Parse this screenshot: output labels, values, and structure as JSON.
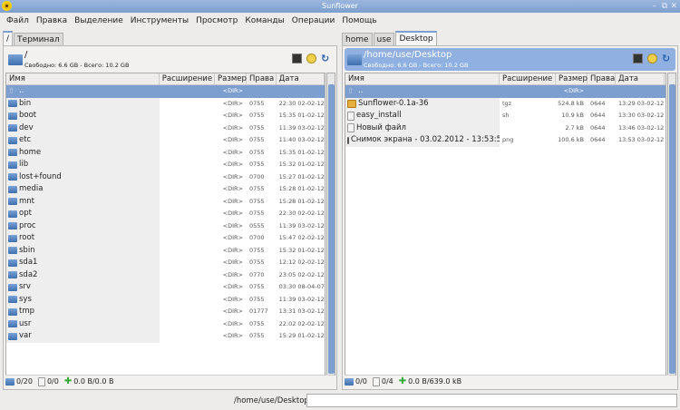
{
  "window": {
    "title": "Sunflower",
    "minimize": "–",
    "maximize": "⧉",
    "close": "✕"
  },
  "menu": [
    "Файл",
    "Правка",
    "Выделение",
    "Инструменты",
    "Просмотр",
    "Команды",
    "Операции",
    "Помощь"
  ],
  "columns": {
    "name": "Имя",
    "ext": "Расширение",
    "size": "Размер",
    "perms": "Права",
    "date": "Дата"
  },
  "left": {
    "tabs": [
      {
        "label": "/",
        "active": true
      },
      {
        "label": "Терминал",
        "active": false
      }
    ],
    "path": "/",
    "free": "Свободно: 6.6 GB - Всего: 10.2 GB",
    "rows": [
      {
        "name": "..",
        "ext": "",
        "size": "<DIR>",
        "perms": "",
        "date": "",
        "icon": "up"
      },
      {
        "name": "bin",
        "ext": "",
        "size": "<DIR>",
        "perms": "0755",
        "date": "22:30 02-02-12",
        "icon": "folder"
      },
      {
        "name": "boot",
        "ext": "",
        "size": "<DIR>",
        "perms": "0755",
        "date": "15:35 01-02-12",
        "icon": "folder"
      },
      {
        "name": "dev",
        "ext": "",
        "size": "<DIR>",
        "perms": "0755",
        "date": "11:39 03-02-12",
        "icon": "folder"
      },
      {
        "name": "etc",
        "ext": "",
        "size": "<DIR>",
        "perms": "0755",
        "date": "11:40 03-02-12",
        "icon": "folder"
      },
      {
        "name": "home",
        "ext": "",
        "size": "<DIR>",
        "perms": "0755",
        "date": "15:35 01-02-12",
        "icon": "folder"
      },
      {
        "name": "lib",
        "ext": "",
        "size": "<DIR>",
        "perms": "0755",
        "date": "15:32 01-02-12",
        "icon": "folder"
      },
      {
        "name": "lost+found",
        "ext": "",
        "size": "<DIR>",
        "perms": "0700",
        "date": "15:27 01-02-12",
        "icon": "folder"
      },
      {
        "name": "media",
        "ext": "",
        "size": "<DIR>",
        "perms": "0755",
        "date": "15:28 01-02-12",
        "icon": "folder"
      },
      {
        "name": "mnt",
        "ext": "",
        "size": "<DIR>",
        "perms": "0755",
        "date": "15:28 01-02-12",
        "icon": "folder"
      },
      {
        "name": "opt",
        "ext": "",
        "size": "<DIR>",
        "perms": "0755",
        "date": "22:30 02-02-12",
        "icon": "folder"
      },
      {
        "name": "proc",
        "ext": "",
        "size": "<DIR>",
        "perms": "0555",
        "date": "11:39 03-02-12",
        "icon": "folder"
      },
      {
        "name": "root",
        "ext": "",
        "size": "<DIR>",
        "perms": "0700",
        "date": "15:47 02-02-12",
        "icon": "folder"
      },
      {
        "name": "sbin",
        "ext": "",
        "size": "<DIR>",
        "perms": "0755",
        "date": "15:32 01-02-12",
        "icon": "folder"
      },
      {
        "name": "sda1",
        "ext": "",
        "size": "<DIR>",
        "perms": "0755",
        "date": "12:12 02-02-12",
        "icon": "folder"
      },
      {
        "name": "sda2",
        "ext": "",
        "size": "<DIR>",
        "perms": "0770",
        "date": "23:05 02-02-12",
        "icon": "folder"
      },
      {
        "name": "srv",
        "ext": "",
        "size": "<DIR>",
        "perms": "0755",
        "date": "03:30 08-04-07",
        "icon": "folder"
      },
      {
        "name": "sys",
        "ext": "",
        "size": "<DIR>",
        "perms": "0755",
        "date": "11:39 03-02-12",
        "icon": "folder"
      },
      {
        "name": "tmp",
        "ext": "",
        "size": "<DIR>",
        "perms": "01777",
        "date": "13:31 03-02-12",
        "icon": "folder"
      },
      {
        "name": "usr",
        "ext": "",
        "size": "<DIR>",
        "perms": "0755",
        "date": "22:02 02-02-12",
        "icon": "folder"
      },
      {
        "name": "var",
        "ext": "",
        "size": "<DIR>",
        "perms": "0755",
        "date": "15:29 01-02-12",
        "icon": "folder"
      }
    ],
    "status": {
      "dirs": "0/20",
      "files": "0/0",
      "size": "0.0 B/0.0 B"
    }
  },
  "right": {
    "tabs": [
      {
        "label": "home",
        "active": false
      },
      {
        "label": "use",
        "active": false
      },
      {
        "label": "Desktop",
        "active": true
      }
    ],
    "path": "/home/use/Desktop",
    "free": "Свободно: 6.6 GB - Всего: 10.2 GB",
    "rows": [
      {
        "name": "..",
        "ext": "",
        "size": "<DIR>",
        "perms": "",
        "date": "",
        "icon": "up"
      },
      {
        "name": "Sunflower-0.1a-36",
        "ext": "tgz",
        "size": "524.8 kB",
        "perms": "0644",
        "date": "13:29 03-02-12",
        "icon": "archive"
      },
      {
        "name": "easy_install",
        "ext": "sh",
        "size": "10.9 kB",
        "perms": "0644",
        "date": "13:30 03-02-12",
        "icon": "file"
      },
      {
        "name": "Новый файл",
        "ext": "",
        "size": "2.7 kB",
        "perms": "0644",
        "date": "13:46 03-02-12",
        "icon": "file"
      },
      {
        "name": "Снимок экрана - 03.02.2012 - 13:53:57",
        "ext": "png",
        "size": "100.6 kB",
        "perms": "0644",
        "date": "13:53 03-02-12",
        "icon": "image"
      }
    ],
    "status": {
      "dirs": "0/0",
      "files": "0/4",
      "size": "0.0 B/639.0 kB"
    }
  },
  "command": {
    "label": "/home/use/Desktop",
    "value": ""
  },
  "colors": {
    "accent": "#7c9fd0"
  }
}
